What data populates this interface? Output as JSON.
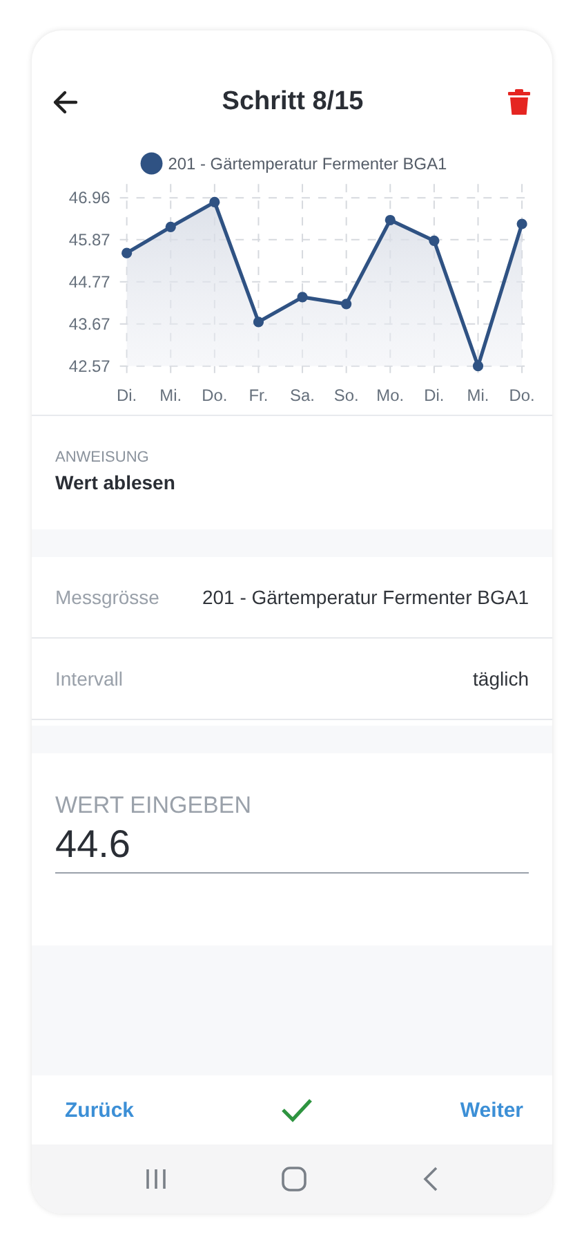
{
  "header": {
    "title": "Schritt 8/15"
  },
  "chart": {
    "chart_data": {
      "type": "area",
      "categories": [
        "Di.",
        "Mi.",
        "Do.",
        "Fr.",
        "Sa.",
        "So.",
        "Mo.",
        "Di.",
        "Mi.",
        "Do."
      ],
      "series": [
        {
          "name": "201 - Gärtemperatur Fermenter BGA1",
          "color": "#2f5283",
          "values": [
            45.52,
            46.2,
            46.85,
            43.72,
            44.37,
            44.19,
            46.38,
            45.84,
            42.57,
            46.28
          ]
        }
      ],
      "grid": true,
      "ylim": [
        42.57,
        46.96
      ],
      "yticks": [
        {
          "value": 42.57,
          "label": "42.57"
        },
        {
          "value": 43.67,
          "label": "43.67"
        },
        {
          "value": 44.77,
          "label": "44.77"
        },
        {
          "value": 45.87,
          "label": "45.87"
        },
        {
          "value": 46.96,
          "label": "46.96"
        }
      ]
    }
  },
  "instruction": {
    "label": "ANWEISUNG",
    "text": "Wert ablesen"
  },
  "details": [
    {
      "label": "Messgrösse",
      "value": "201 - Gärtemperatur Fermenter BGA1"
    },
    {
      "label": "Intervall",
      "value": "täglich"
    }
  ],
  "input": {
    "label": "WERT EINGEBEN",
    "value": "44.6"
  },
  "footer": {
    "back": "Zurück",
    "next": "Weiter"
  }
}
